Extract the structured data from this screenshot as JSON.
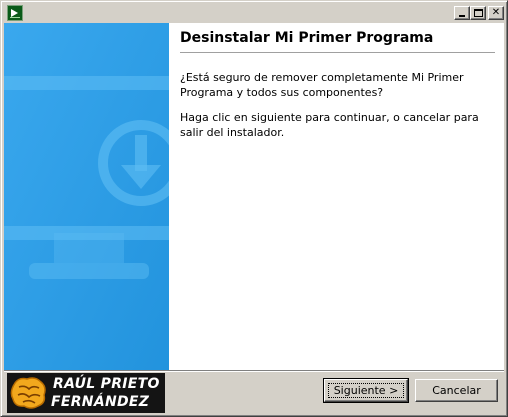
{
  "window": {
    "icon": "installer-app-icon",
    "controls": {
      "minimize_icon": "minimize-icon",
      "maximize_icon": "maximize-icon",
      "close_glyph": "✕"
    }
  },
  "sidebar": {
    "icon": "monitor-download-icon",
    "background_color": "#2ea0e8"
  },
  "content": {
    "title": "Desinstalar Mi Primer Programa",
    "paragraph1": "¿Está seguro de remover completamente Mi Primer Programa y todos sus componentes?",
    "paragraph2": "Haga clic en siguiente para continuar, o cancelar para salir del instalador."
  },
  "footer": {
    "logo_line1": "RAÚL PRIETO",
    "logo_line2": "FERNÁNDEZ",
    "next_label": "Siguiente >",
    "cancel_label": "Cancelar"
  }
}
